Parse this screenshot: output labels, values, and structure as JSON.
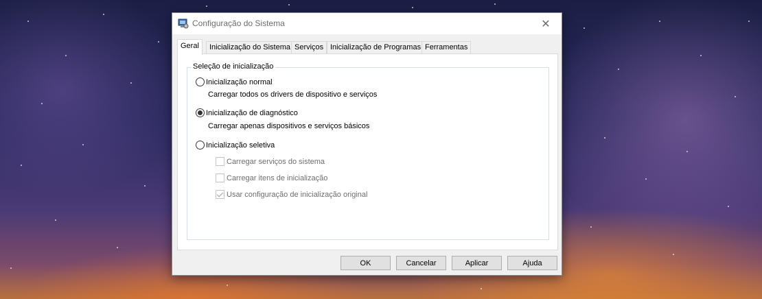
{
  "window": {
    "title": "Configuração do Sistema",
    "title_icon": "msconfig-icon",
    "close_icon": "close-icon"
  },
  "tabs": [
    {
      "label": "Geral",
      "active": true
    },
    {
      "label": "Inicialização do Sistema",
      "active": false
    },
    {
      "label": "Serviços",
      "active": false
    },
    {
      "label": "Inicialização de Programas",
      "active": false
    },
    {
      "label": "Ferramentas",
      "active": false
    }
  ],
  "startup_selection": {
    "legend": "Seleção de inicialização",
    "normal": {
      "label": "Inicialização normal",
      "description": "Carregar todos os drivers de dispositivo e serviços",
      "checked": false
    },
    "diagnostic": {
      "label": "Inicialização de diagnóstico",
      "description": "Carregar apenas dispositivos e serviços básicos",
      "checked": true
    },
    "selective": {
      "label": "Inicialização seletiva",
      "checked": false,
      "options": [
        {
          "label": "Carregar serviços do sistema",
          "checked": false,
          "enabled": false
        },
        {
          "label": "Carregar itens de inicialização",
          "checked": false,
          "enabled": false
        },
        {
          "label": "Usar configuração de inicialização original",
          "checked": true,
          "enabled": false
        }
      ]
    }
  },
  "buttons": {
    "ok": "OK",
    "cancel": "Cancelar",
    "apply": "Aplicar",
    "help": "Ajuda"
  }
}
